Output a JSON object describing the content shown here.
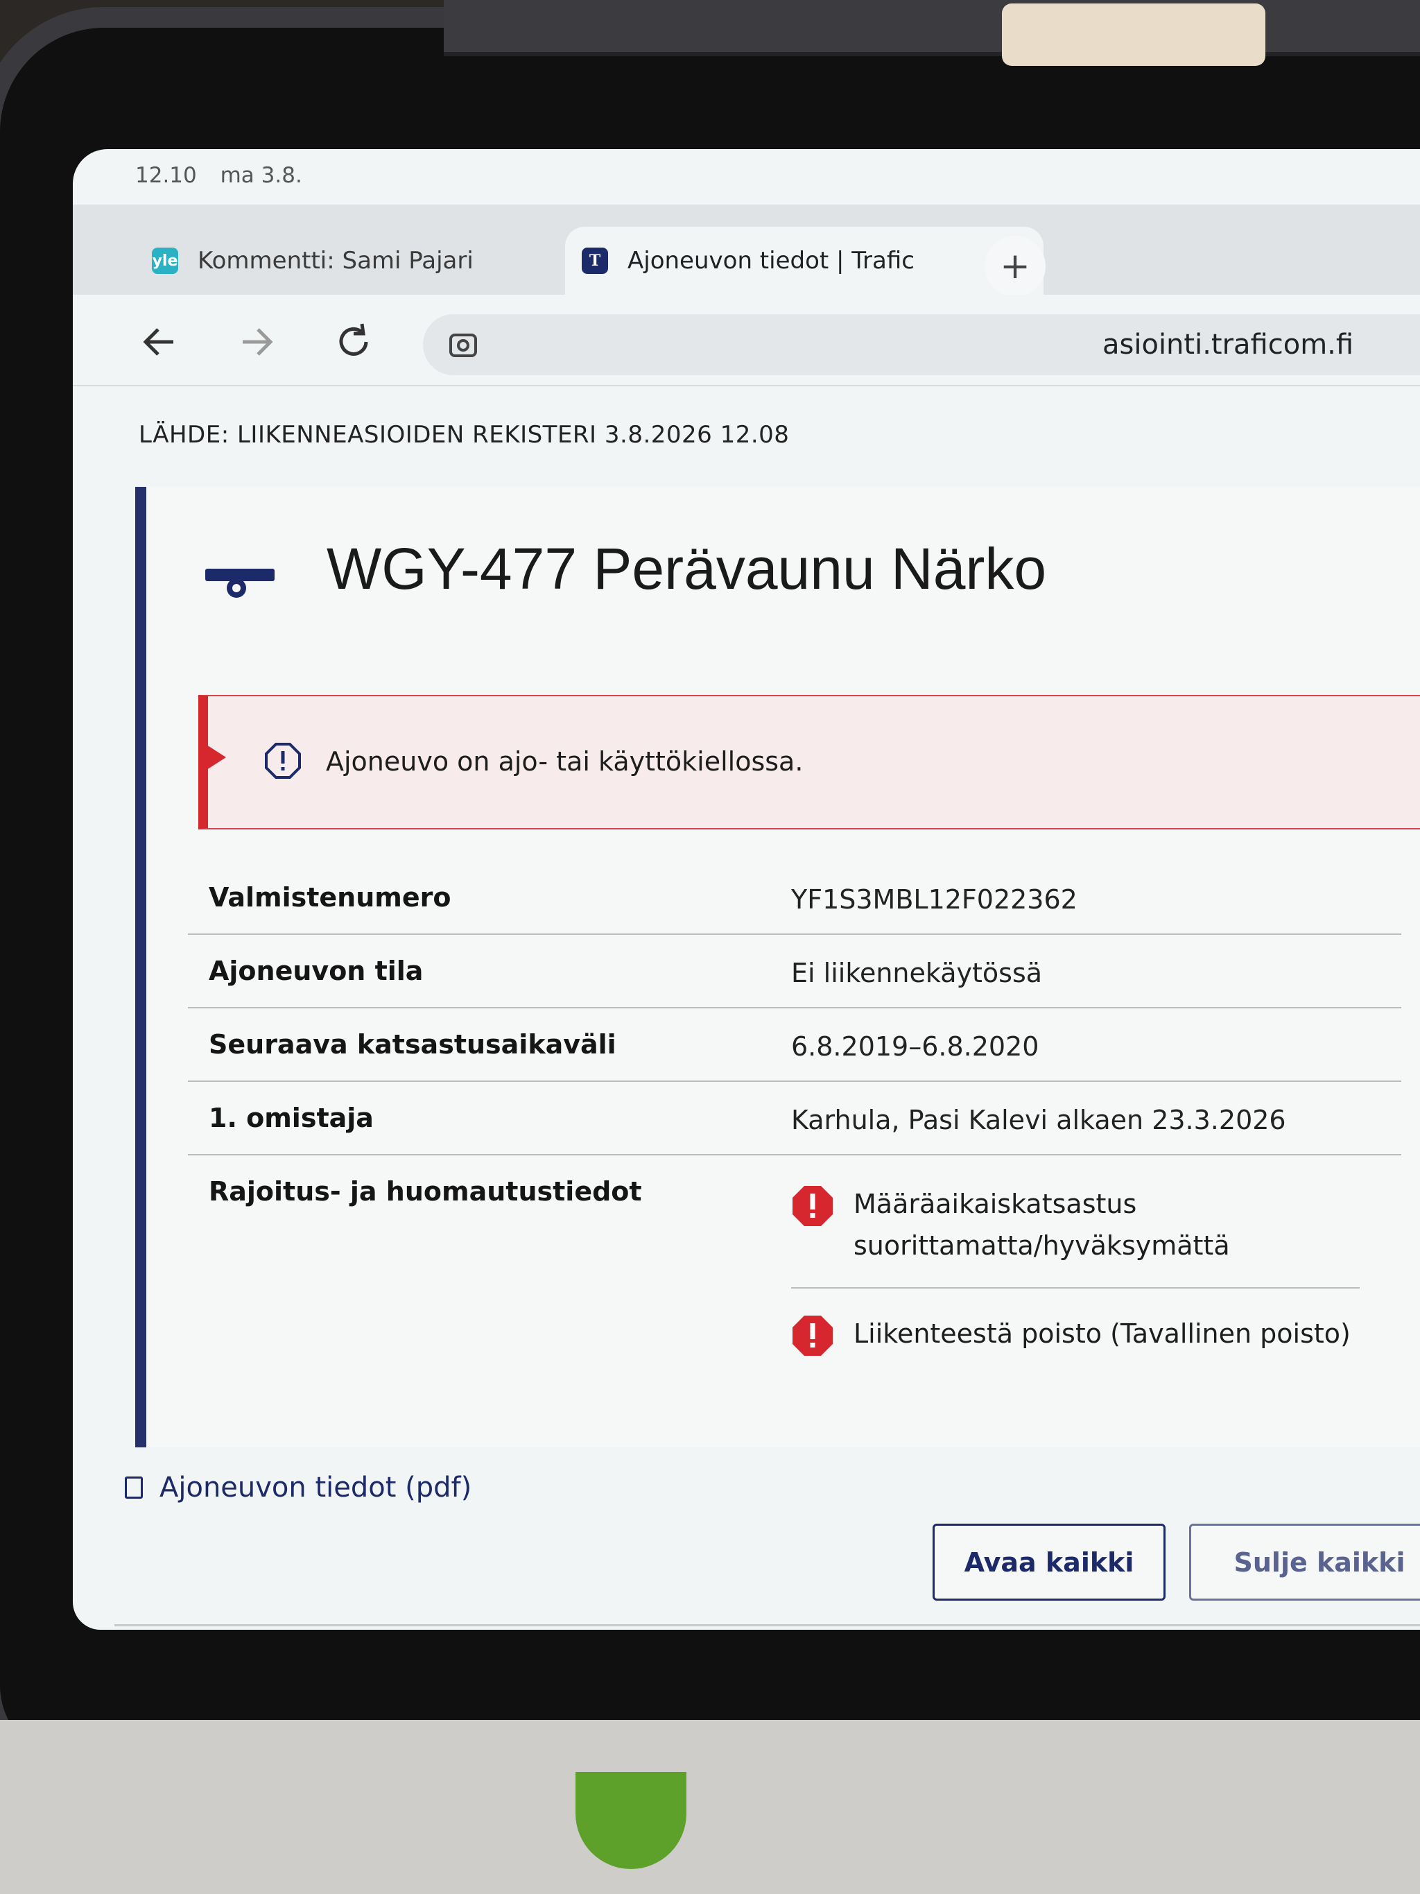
{
  "status_bar": {
    "time": "12.10",
    "date": "ma 3.8."
  },
  "tabs": [
    {
      "label": "Kommentti: Sami Pajari",
      "favicon": "yle",
      "close": "✕"
    },
    {
      "label": "Ajoneuvon tiedot | Trafic",
      "favicon": "T",
      "close": "✕"
    }
  ],
  "new_tab": "+",
  "omnibox": {
    "url": "asiointi.traficom.fi"
  },
  "source_line": "LÄHDE: LIIKENNEASIOIDEN REKISTERI 3.8.2026 12.08",
  "vehicle": {
    "icon": "trailer-icon",
    "title": "WGY-477 Perävaunu Närko"
  },
  "alert": {
    "icon": "warning-octagon-icon",
    "text": "Ajoneuvo on ajo- tai käyttökiellossa.",
    "color": "#d6262e"
  },
  "details": [
    {
      "label": "Valmistenumero",
      "value": "YF1S3MBL12F022362"
    },
    {
      "label": "Ajoneuvon tila",
      "value": "Ei liikennekäytössä"
    },
    {
      "label": "Seuraava katsastusaikaväli",
      "value": "6.8.2019–6.8.2020"
    },
    {
      "label": "1. omistaja",
      "value": "Karhula, Pasi Kalevi alkaen 23.3.2026"
    }
  ],
  "restrictions": {
    "label": "Rajoitus- ja huomautustiedot",
    "items": [
      "Määräaikaiskatsastus suorittamatta/hyväksymättä",
      "Liikenteestä poisto (Tavallinen poisto)"
    ],
    "icon_color": "#d6262e"
  },
  "pdf_link": "Ajoneuvon tiedot (pdf)",
  "buttons": {
    "open_all": "Avaa kaikki",
    "close_all": "Sulje kaikki"
  },
  "colors": {
    "brand": "#1d2a6a",
    "accent_border": "#26306b"
  }
}
